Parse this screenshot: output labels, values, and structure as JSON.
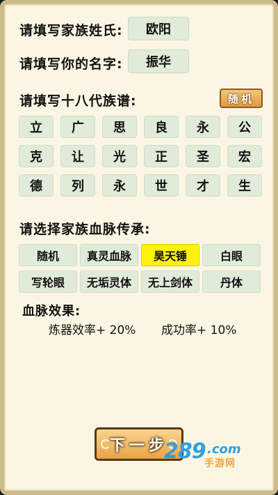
{
  "form": {
    "surname_label": "请填写家族姓氏:",
    "surname_value": "欧阳",
    "name_label": "请填写你的名字:",
    "name_value": "振华",
    "genealogy_label": "请填写十八代族谱:",
    "random_button": "随机",
    "genealogy": [
      "立",
      "广",
      "思",
      "良",
      "永",
      "公",
      "克",
      "让",
      "光",
      "正",
      "圣",
      "宏",
      "德",
      "列",
      "永",
      "世",
      "才",
      "生"
    ],
    "bloodline_label": "请选择家族血脉传承:",
    "bloodlines": [
      "随机",
      "真灵血脉",
      "昊天锤",
      "白眼",
      "写轮眼",
      "无垢灵体",
      "无上剑体",
      "丹体"
    ],
    "selected_bloodline": "昊天锤",
    "effect_title": "血脉效果:",
    "effect_1": "炼器效率+ 20%",
    "effect_2": "成功率+ 10%",
    "next_button": "下一步"
  },
  "watermark": {
    "number": "289",
    "domain": ".com",
    "site": "手游网"
  },
  "colors": {
    "field": "#e1ebd9",
    "selected": "#fdf20c",
    "button": "#e8a447",
    "panel": "#fbf6e3"
  }
}
